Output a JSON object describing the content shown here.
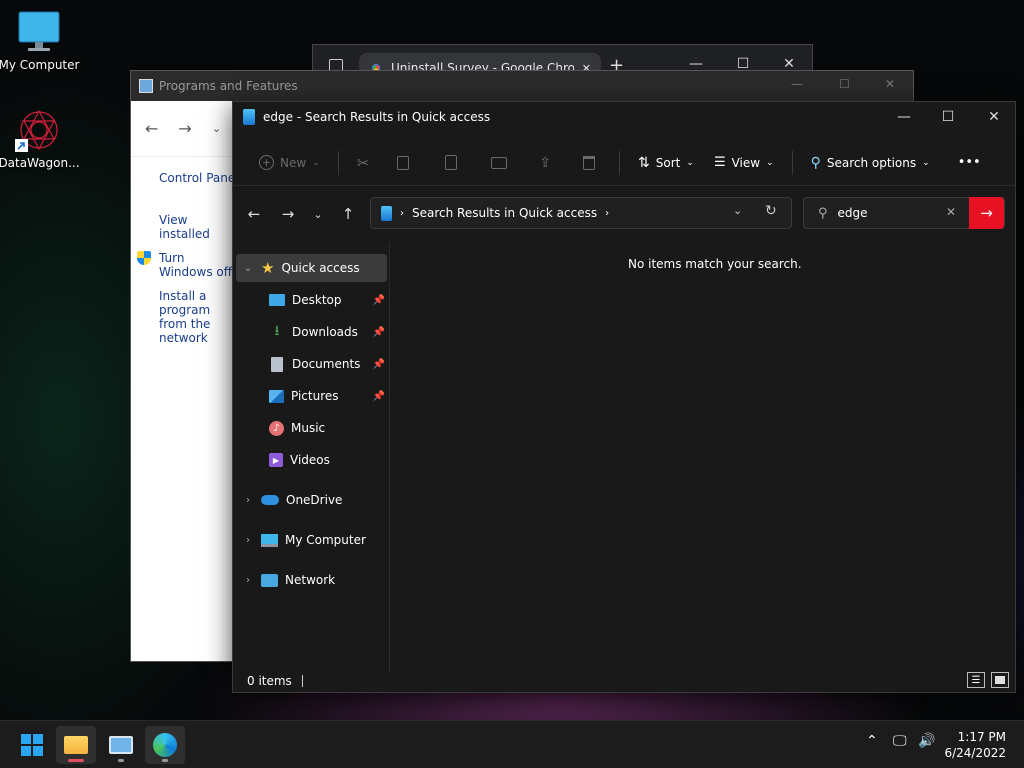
{
  "desktop": {
    "icons": [
      {
        "label": "My Computer"
      },
      {
        "label": "DataWagon..."
      }
    ]
  },
  "chrome": {
    "tab_title": "Uninstall Survey - Google Chrome",
    "new_tab": "+",
    "close_tab": "✕",
    "minimize": "—",
    "maximize": "☐",
    "close": "✕"
  },
  "programs": {
    "title": "Programs and Features",
    "links": [
      "Control Panel",
      "View installed",
      "Turn Windows off",
      "Install a program from the network"
    ]
  },
  "explorer": {
    "title": "edge - Search Results in Quick access",
    "commands": {
      "new": "New",
      "sort": "Sort",
      "view": "View",
      "search_options": "Search options",
      "more": "•••"
    },
    "address": {
      "path": "Search Results in Quick access"
    },
    "search": {
      "value": "edge"
    },
    "nav": {
      "quick_access": "Quick access",
      "items": [
        "Desktop",
        "Downloads",
        "Documents",
        "Pictures",
        "Music",
        "Videos"
      ],
      "onedrive": "OneDrive",
      "my_computer": "My Computer",
      "network": "Network"
    },
    "empty_message": "No items match your search.",
    "status": "0 items"
  },
  "taskbar": {
    "time": "1:17 PM",
    "date": "6/24/2022"
  }
}
